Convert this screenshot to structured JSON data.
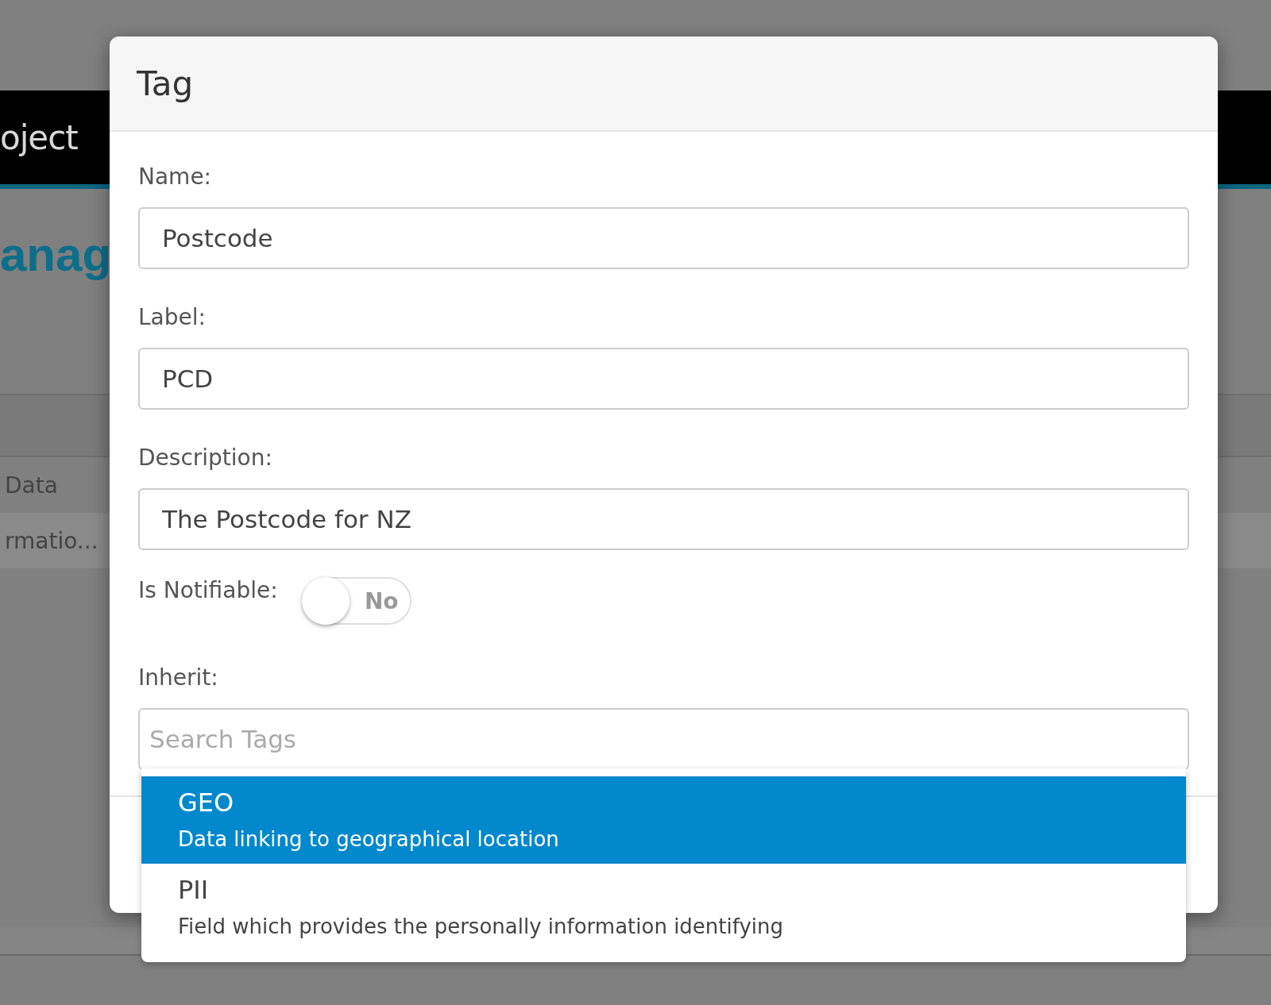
{
  "background": {
    "header_text": "oject",
    "page_title": "anag",
    "table_rows": [
      "Data",
      "rmatio..."
    ]
  },
  "modal": {
    "title": "Tag",
    "fields": [
      {
        "label": "Name:",
        "value": "Postcode"
      },
      {
        "label": "Label:",
        "value": "PCD"
      },
      {
        "label": "Description:",
        "value": "The Postcode for NZ"
      }
    ],
    "notifiable": {
      "label": "Is Notifiable:",
      "on": false,
      "state_text": "No"
    },
    "inherit": {
      "label": "Inherit:",
      "placeholder": "Search Tags",
      "options": [
        {
          "name": "GEO",
          "description": "Data linking to geographical location",
          "selected": true
        },
        {
          "name": "PII",
          "description": "Field which provides the personally information identifying",
          "selected": false
        }
      ]
    }
  }
}
